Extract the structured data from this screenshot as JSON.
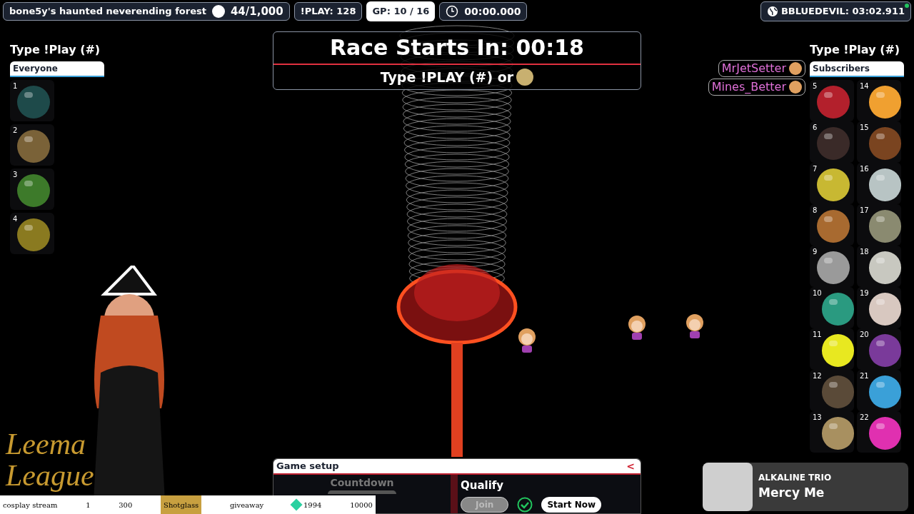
{
  "top_bar": {
    "title": "bone5y's haunted neverending forest",
    "count": "44/1,000",
    "play": "!PLAY: 128",
    "gp": "GP: 10 / 16",
    "timer": "00:00.000",
    "record": "BBLUEDEVIL: 03:02.911"
  },
  "banner": {
    "title": "Race Starts In: 00:18",
    "subtitle": "Type !PLAY (#) or"
  },
  "left_panel": {
    "heading": "Type !Play (#)",
    "tab": "Everyone",
    "marbles": [
      {
        "number": "1",
        "color": "#1e4a4a"
      },
      {
        "number": "2",
        "color": "#7a6238"
      },
      {
        "number": "3",
        "color": "#3d7a2a"
      },
      {
        "number": "4",
        "color": "#8a7a20"
      }
    ]
  },
  "right_panel": {
    "heading": "Type !Play (#)",
    "tab": "Subscribers",
    "columns": [
      [
        {
          "number": "5",
          "color": "#b3202c"
        },
        {
          "number": "6",
          "color": "#3a2a28"
        },
        {
          "number": "7",
          "color": "#c8b832"
        },
        {
          "number": "8",
          "color": "#a86a30"
        },
        {
          "number": "9",
          "color": "#9a9a9a"
        },
        {
          "number": "10",
          "color": "#2a9a80"
        },
        {
          "number": "11",
          "color": "#e8e820"
        },
        {
          "number": "12",
          "color": "#5a4a38"
        },
        {
          "number": "13",
          "color": "#a89060"
        }
      ],
      [
        {
          "number": "14",
          "color": "#f0a030"
        },
        {
          "number": "15",
          "color": "#7a4420"
        },
        {
          "number": "16",
          "color": "#b8c4c4"
        },
        {
          "number": "17",
          "color": "#8a8a70"
        },
        {
          "number": "18",
          "color": "#c8c8c0"
        },
        {
          "number": "19",
          "color": "#d8c8c0"
        },
        {
          "number": "20",
          "color": "#7a3a9a"
        },
        {
          "number": "21",
          "color": "#3aa0d8"
        },
        {
          "number": "22",
          "color": "#e030b0"
        }
      ]
    ]
  },
  "players": [
    "MrJetSetter",
    "Mines_Better"
  ],
  "logo": [
    "Leema",
    "League"
  ],
  "ticker": [
    {
      "text": "cosplay stream",
      "kind": "plain"
    },
    {
      "text": "1",
      "kind": "plain"
    },
    {
      "text": "300",
      "kind": "plain"
    },
    {
      "text": "Shotglass",
      "kind": "highlight"
    },
    {
      "text": "giveaway",
      "kind": "plain"
    },
    {
      "text": "1994",
      "kind": "gem"
    },
    {
      "text": "10000",
      "kind": "plain"
    }
  ],
  "game_setup": {
    "title": "Game setup",
    "collapse": "<",
    "countdown": {
      "label": "Countdown",
      "disabled": true
    },
    "qualify": {
      "label": "Qualify",
      "join": {
        "label": "Join",
        "disabled": true
      },
      "checked": true,
      "start": "Start Now"
    }
  },
  "now_playing": {
    "artist": "ALKALINE TRIO",
    "song": "Mercy Me"
  }
}
